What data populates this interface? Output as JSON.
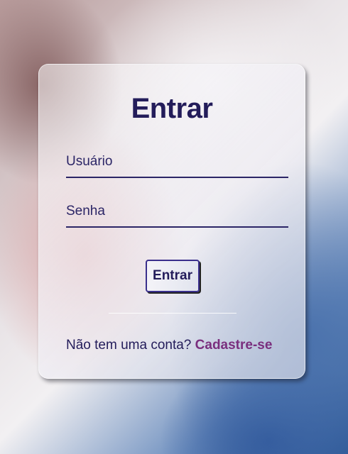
{
  "login": {
    "title": "Entrar",
    "username_label": "Usuário",
    "password_label": "Senha",
    "submit_label": "Entrar",
    "signup_prompt": "Não tem uma conta?",
    "signup_link": "Cadastre-se"
  },
  "colors": {
    "primary_text": "#231c5a",
    "link": "#7a2f7e",
    "button_border": "#3a2f8c"
  }
}
